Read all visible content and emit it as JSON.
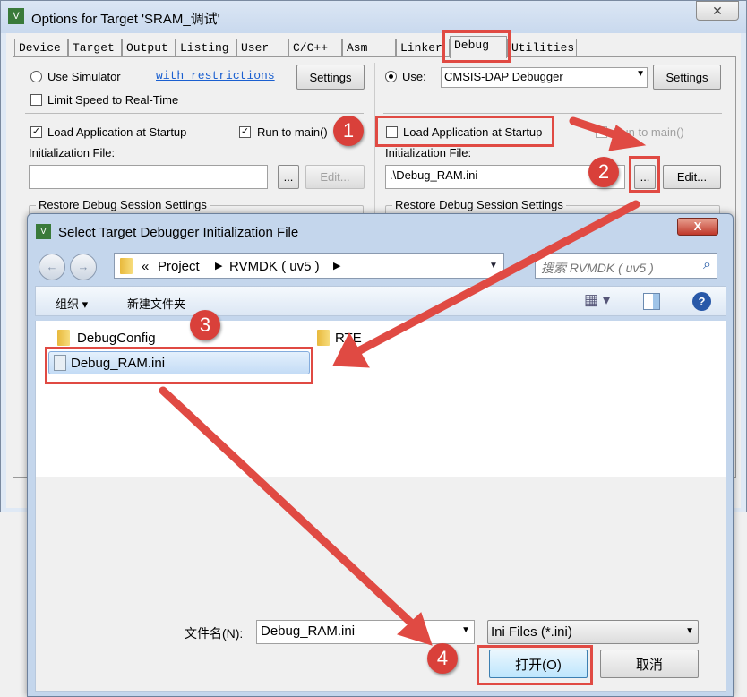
{
  "main_window": {
    "title": "Options for Target 'SRAM_调试'",
    "close": "✕",
    "tabs": [
      "Device",
      "Target",
      "Output",
      "Listing",
      "User",
      "C/C++",
      "Asm",
      "Linker",
      "Debug",
      "Utilities"
    ],
    "active_tab": "Debug",
    "left": {
      "use_simulator": "Use Simulator",
      "restrictions_link": "with restrictions",
      "settings": "Settings",
      "limit_speed": "Limit Speed to Real-Time",
      "load_app": "Load Application at Startup",
      "run_to_main": "Run to main()",
      "init_file_label": "Initialization File:",
      "init_file_value": "",
      "browse": "...",
      "edit": "Edit...",
      "restore_group": "Restore Debug Session Settings"
    },
    "right": {
      "use_label": "Use:",
      "debugger": "CMSIS-DAP Debugger",
      "settings": "Settings",
      "load_app": "Load Application at Startup",
      "run_to_main": "Run to main()",
      "init_file_label": "Initialization File:",
      "init_file_value": ".\\Debug_RAM.ini",
      "browse": "...",
      "edit": "Edit...",
      "restore_group": "Restore Debug Session Settings"
    }
  },
  "file_dialog": {
    "title": "Select Target Debugger Initialization File",
    "close": "X",
    "breadcrumb": [
      "«",
      "Project",
      "RVMDK ( uv5 )"
    ],
    "search_placeholder": "搜索 RVMDK ( uv5 )",
    "toolbar": {
      "organize": "组织 ▾",
      "new_folder": "新建文件夹"
    },
    "items": [
      {
        "name": "DebugConfig",
        "type": "folder"
      },
      {
        "name": "RTE",
        "type": "folder"
      },
      {
        "name": "Debug_RAM.ini",
        "type": "file",
        "selected": true
      }
    ],
    "filename_label": "文件名(N):",
    "filename_value": "Debug_RAM.ini",
    "filetype": "Ini Files (*.ini)",
    "open": "打开(O)",
    "cancel": "取消"
  },
  "annotations": {
    "steps": [
      "1",
      "2",
      "3",
      "4"
    ],
    "color": "#e04a43"
  }
}
